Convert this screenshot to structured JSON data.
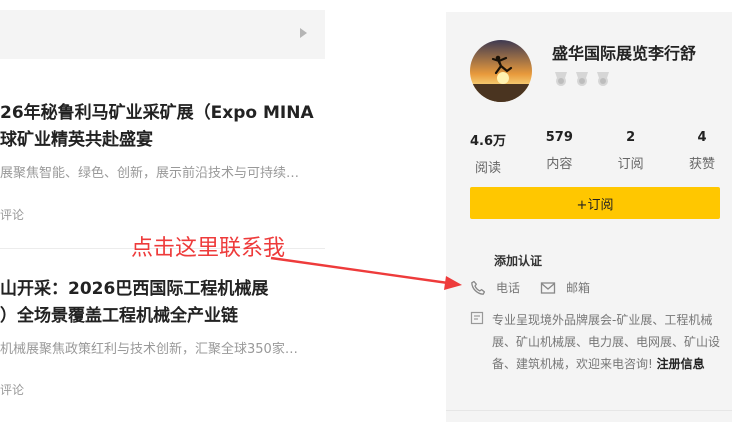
{
  "articles": [
    {
      "title_line1": "26年秘鲁利马矿业采矿展（Expo MINA",
      "title_line2": "球矿业精英共赴盛宴",
      "description": "展聚焦智能、绿色、创新，展示前沿技术与可持续…",
      "meta": "评论"
    },
    {
      "title_line1": "山开采：2026巴西国际工程机械展",
      "title_line2": "）全场景覆盖工程机械全产业链",
      "description": "机械展聚焦政策红利与技术创新，汇聚全球350家…",
      "meta": "评论"
    }
  ],
  "annotation": "点击这里联系我",
  "profile": {
    "name": "盛华国际展览李行舒",
    "stats": [
      {
        "value": "4.6万",
        "label": "阅读"
      },
      {
        "value": "579",
        "label": "内容"
      },
      {
        "value": "2",
        "label": "订阅"
      },
      {
        "value": "4",
        "label": "获赞"
      }
    ],
    "subscribe_label": "+订阅",
    "certification": "添加认证",
    "phone_label": "电话",
    "email_label": "邮箱",
    "intro": "专业呈现境外品牌展会-矿业展、工程机械展、矿山机械展、电力展、电网展、矿山设备、建筑机械，欢迎来电咨询!",
    "register_link": "注册信息"
  },
  "colors": {
    "accent": "#ffc700",
    "annotation_red": "#ee3b3b",
    "panel_bg": "#f4f4f4"
  }
}
